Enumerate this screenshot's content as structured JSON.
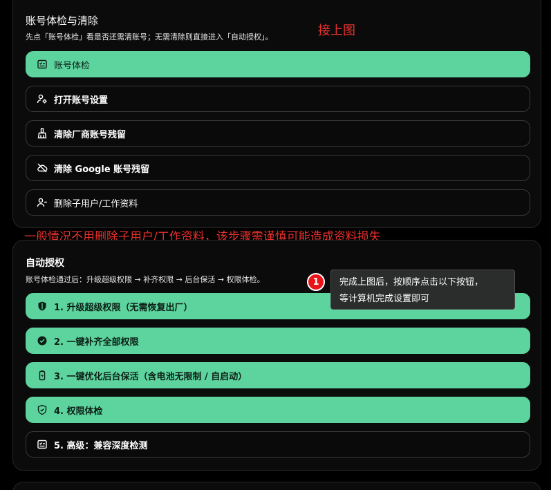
{
  "colors": {
    "accent_green": "#5dd39e",
    "annotation_red": "#e8322e",
    "badge_red": "#e8141a"
  },
  "section1": {
    "title": "账号体检与清除",
    "description": "先点「账号体检」看是否还需清账号；无需清除则直接进入「自动授权」。",
    "buttons": [
      {
        "label": "账号体检",
        "icon": "checklist-icon"
      },
      {
        "label": "打开账号设置",
        "icon": "user-gear-icon"
      },
      {
        "label": "清除厂商账号残留",
        "icon": "broom-icon"
      },
      {
        "label": "清除 Google 账号残留",
        "icon": "cloud-off-icon"
      },
      {
        "label": "删除子用户/工作资料",
        "icon": "user-remove-icon"
      }
    ]
  },
  "section2": {
    "title": "自动授权",
    "description": "账号体检通过后：升级超级权限 → 补齐权限 → 后台保活 → 权限体检。",
    "buttons": [
      {
        "label": "1. 升级超级权限（无需恢复出厂）",
        "icon": "shield-icon"
      },
      {
        "label": "2. 一键补齐全部权限",
        "icon": "circle-check-icon"
      },
      {
        "label": "3. 一键优化后台保活（含电池无限制 / 自启动）",
        "icon": "battery-icon"
      },
      {
        "label": "4. 权限体检",
        "icon": "shield-check-icon"
      },
      {
        "label": "5. 高级：兼容深度检测",
        "icon": "checklist-icon"
      }
    ]
  },
  "annotations": {
    "continue_label": "接上图",
    "warning": "一般情况不用删除子用户/工作资料，该步骤需谨慎可能造成资料损失",
    "step_number": "1",
    "tooltip_line1": "完成上图后，按顺序点击以下按钮，",
    "tooltip_line2": "等计算机完成设置即可"
  }
}
